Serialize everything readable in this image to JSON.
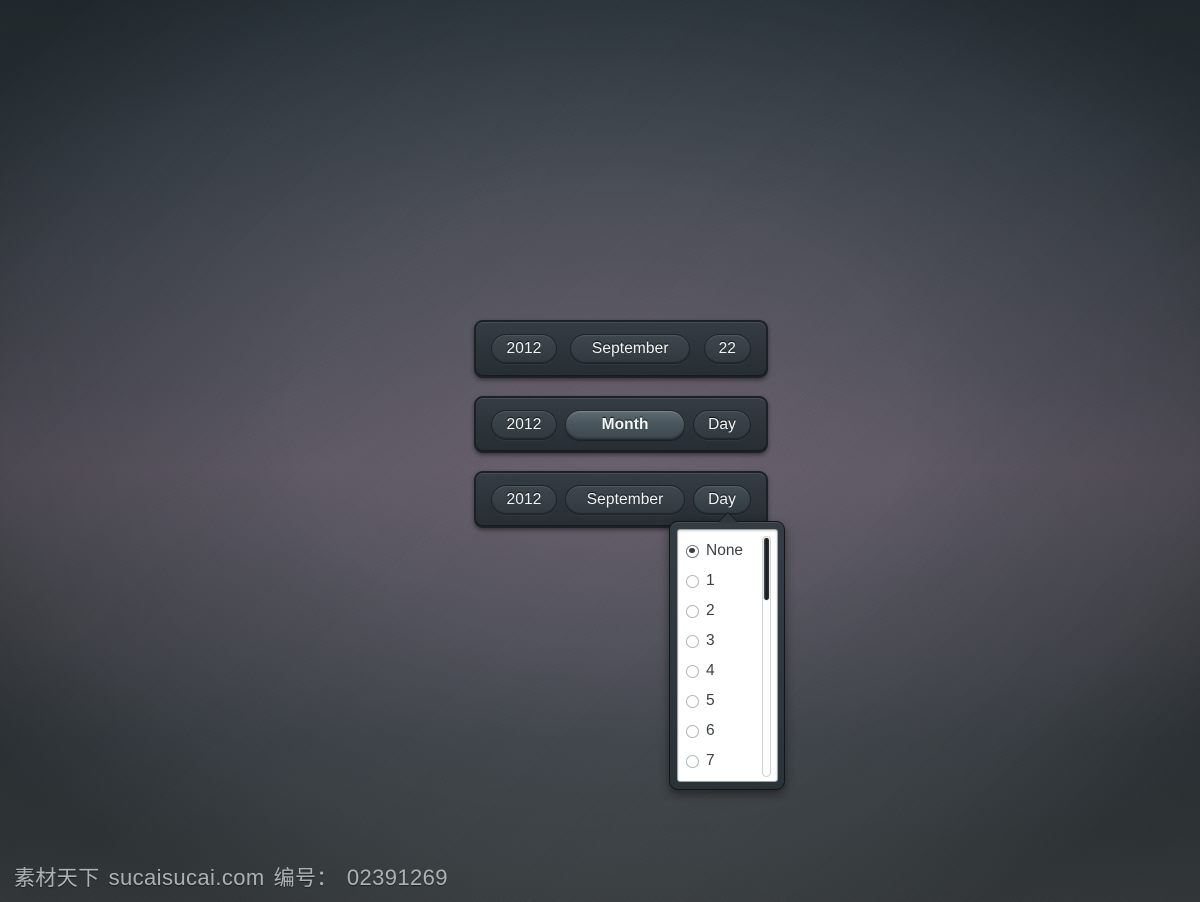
{
  "background": {
    "top_color": "#2e3a41",
    "mid_color": "#5a5560",
    "bottom_color": "#4a5155"
  },
  "toolbars": [
    {
      "name": "date-bar-resolved",
      "pills": [
        {
          "name": "year",
          "label": "2012",
          "state": "normal"
        },
        {
          "name": "month",
          "label": "September",
          "state": "normal"
        },
        {
          "name": "day",
          "label": "22",
          "state": "normal"
        }
      ]
    },
    {
      "name": "date-bar-month-hover",
      "pills": [
        {
          "name": "year",
          "label": "2012",
          "state": "normal"
        },
        {
          "name": "month",
          "label": "Month",
          "state": "active"
        },
        {
          "name": "day",
          "label": "Day",
          "state": "normal"
        }
      ]
    },
    {
      "name": "date-bar-day-open",
      "pills": [
        {
          "name": "year",
          "label": "2012",
          "state": "normal"
        },
        {
          "name": "month",
          "label": "September",
          "state": "normal"
        },
        {
          "name": "day",
          "label": "Day",
          "state": "opened"
        }
      ]
    }
  ],
  "dropdown": {
    "name": "day-picker-dropdown",
    "anchor_pill": "Day",
    "selected_value": "None",
    "arrow_icon": "caret-up-icon",
    "options": [
      {
        "label": "None",
        "checked": true
      },
      {
        "label": "1",
        "checked": false
      },
      {
        "label": "2",
        "checked": false
      },
      {
        "label": "3",
        "checked": false
      },
      {
        "label": "4",
        "checked": false
      },
      {
        "label": "5",
        "checked": false
      },
      {
        "label": "6",
        "checked": false
      },
      {
        "label": "7",
        "checked": false
      }
    ],
    "scrollbar": {
      "name": "dropdown-scrollbar",
      "thumb_position": "top",
      "thumb_fraction": 0.26
    }
  },
  "watermark": {
    "site_cn": "素材天下",
    "site_url": "sucaisucai.com",
    "id_label": "编号：",
    "id_value": "02391269"
  }
}
